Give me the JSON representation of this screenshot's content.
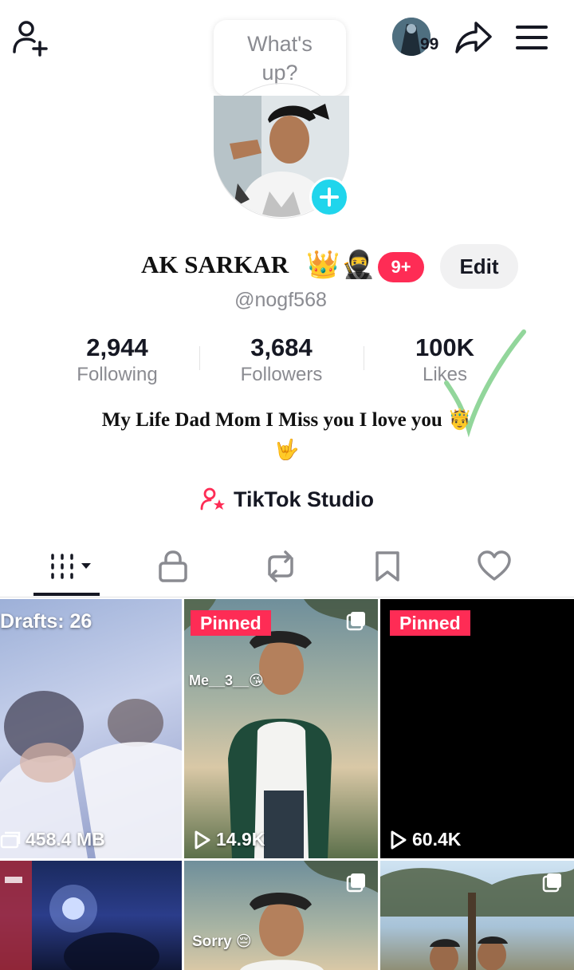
{
  "header": {
    "status_bubble": "What's up?",
    "visitor_badge": "99"
  },
  "profile": {
    "display_name": "AK SARKAR",
    "name_emojis": [
      "👑",
      "🥷"
    ],
    "notification_count": "9+",
    "edit_label": "Edit",
    "username": "@nogf568",
    "stats": [
      {
        "value": "2,944",
        "label": "Following"
      },
      {
        "value": "3,684",
        "label": "Followers"
      },
      {
        "value": "100K",
        "label": "Likes"
      }
    ],
    "bio_line1": "My Life Dad Mom I Miss you I love you 🤴",
    "bio_line2": "🤟",
    "studio_label": "TikTok Studio"
  },
  "tabs": [
    "videos-grid-icon",
    "lock-icon",
    "repost-icon",
    "bookmark-icon",
    "heart-icon"
  ],
  "grid": {
    "drafts_label": "Drafts: 26",
    "drafts_size": "458.4 MB",
    "tiles": [
      {
        "pinned": "Pinned",
        "views": "14.9K",
        "caption": "Me__3__😘"
      },
      {
        "pinned": "Pinned",
        "views": "60.4K"
      },
      {
        "caption": "Sorry 😔"
      }
    ]
  },
  "colors": {
    "accent_red": "#fe2c55",
    "accent_cyan": "#20d5ec",
    "text_primary": "#161823",
    "text_secondary": "#8a8b91"
  }
}
